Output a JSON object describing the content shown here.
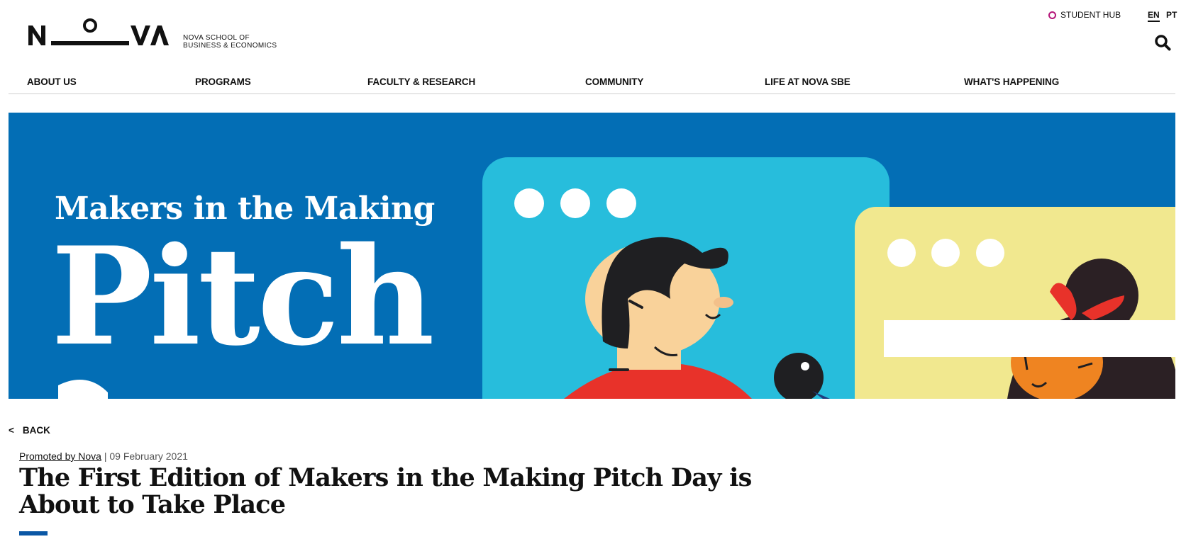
{
  "brand": {
    "logo_text": "N O VA",
    "school_line1": "NOVA SCHOOL OF",
    "school_line2": "BUSINESS & ECONOMICS"
  },
  "topbar": {
    "student_hub": "STUDENT HUB",
    "lang_en": "EN",
    "lang_pt": "PT",
    "accent_color": "#b5177a"
  },
  "nav": {
    "items": [
      {
        "label": "ABOUT US"
      },
      {
        "label": "PROGRAMS"
      },
      {
        "label": "FACULTY & RESEARCH"
      },
      {
        "label": "COMMUNITY"
      },
      {
        "label": "LIFE AT NOVA SBE"
      },
      {
        "label": "WHAT'S HAPPENING"
      }
    ]
  },
  "hero": {
    "subtitle": "Makers in the Making",
    "title": "Pitch",
    "background_color": "#036eb5"
  },
  "article": {
    "back_label": "BACK",
    "promoted_by": "Promoted by Nova",
    "date": "09 February 2021",
    "separator": "|",
    "title": "The First Edition of Makers in the Making Pitch Day is About to Take Place"
  }
}
